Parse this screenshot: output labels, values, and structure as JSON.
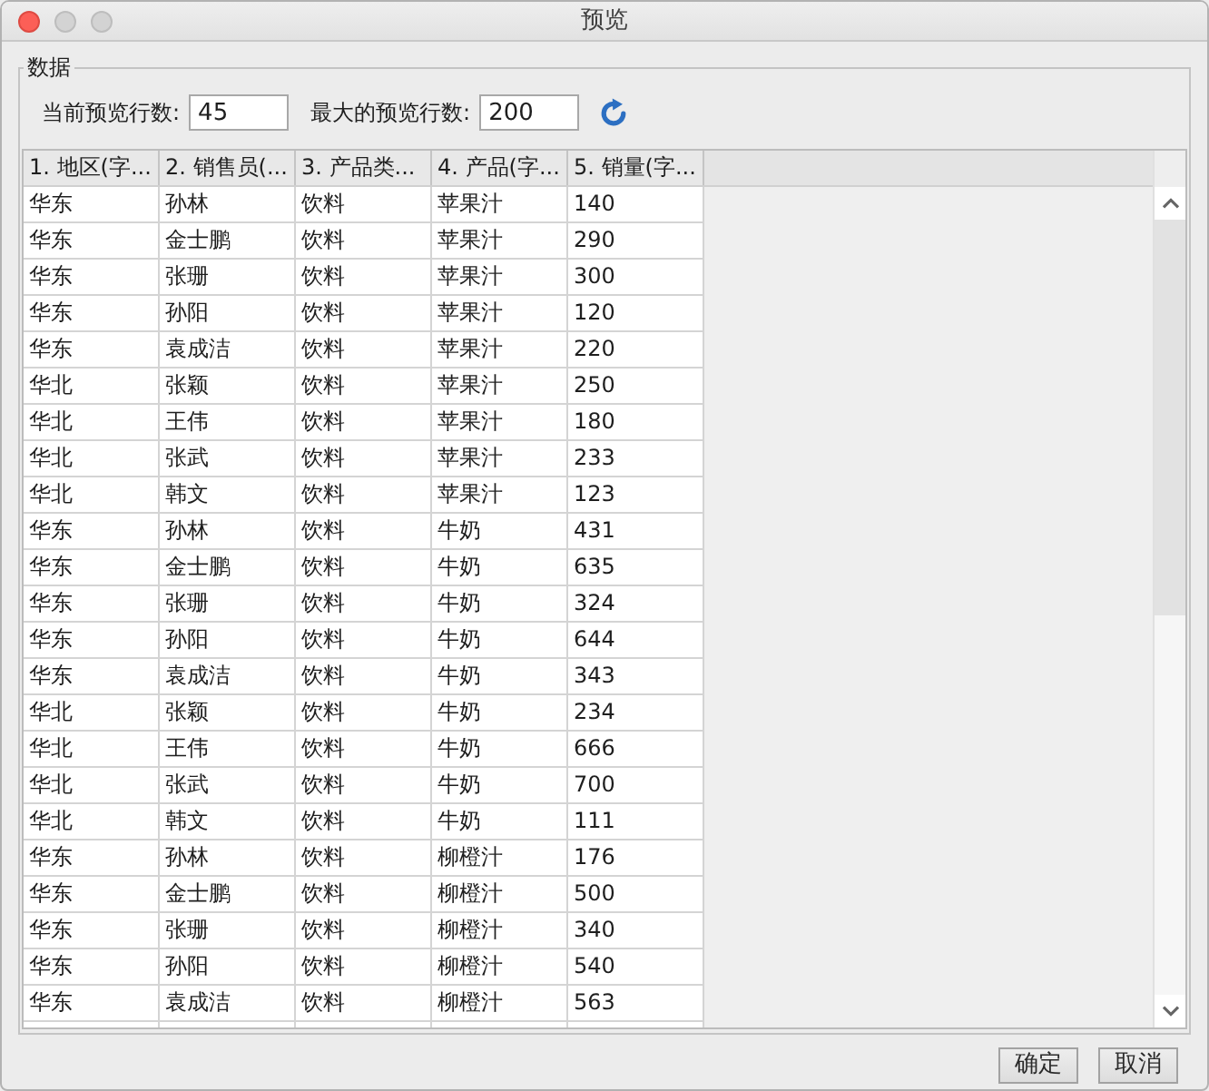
{
  "window": {
    "title": "预览",
    "controls": [
      {
        "kind": "close",
        "disabled": false
      },
      {
        "kind": "minimize",
        "disabled": true
      },
      {
        "kind": "zoom",
        "disabled": true
      }
    ]
  },
  "group": {
    "legend": "数据"
  },
  "fields": [
    {
      "label": "当前预览行数:",
      "value": "45"
    },
    {
      "label": "最大的预览行数:",
      "value": "200"
    }
  ],
  "table": {
    "columns": [
      "1. 地区(字...",
      "2. 销售员(...",
      "3. 产品类...",
      "4. 产品(字...",
      "5. 销量(字..."
    ],
    "rows": [
      [
        "华东",
        "孙林",
        "饮料",
        "苹果汁",
        "140"
      ],
      [
        "华东",
        "金士鹏",
        "饮料",
        "苹果汁",
        "290"
      ],
      [
        "华东",
        "张珊",
        "饮料",
        "苹果汁",
        "300"
      ],
      [
        "华东",
        "孙阳",
        "饮料",
        "苹果汁",
        "120"
      ],
      [
        "华东",
        "袁成洁",
        "饮料",
        "苹果汁",
        "220"
      ],
      [
        "华北",
        "张颖",
        "饮料",
        "苹果汁",
        "250"
      ],
      [
        "华北",
        "王伟",
        "饮料",
        "苹果汁",
        "180"
      ],
      [
        "华北",
        "张武",
        "饮料",
        "苹果汁",
        "233"
      ],
      [
        "华北",
        "韩文",
        "饮料",
        "苹果汁",
        "123"
      ],
      [
        "华东",
        "孙林",
        "饮料",
        "牛奶",
        "431"
      ],
      [
        "华东",
        "金士鹏",
        "饮料",
        "牛奶",
        "635"
      ],
      [
        "华东",
        "张珊",
        "饮料",
        "牛奶",
        "324"
      ],
      [
        "华东",
        "孙阳",
        "饮料",
        "牛奶",
        "644"
      ],
      [
        "华东",
        "袁成洁",
        "饮料",
        "牛奶",
        "343"
      ],
      [
        "华北",
        "张颖",
        "饮料",
        "牛奶",
        "234"
      ],
      [
        "华北",
        "王伟",
        "饮料",
        "牛奶",
        "666"
      ],
      [
        "华北",
        "张武",
        "饮料",
        "牛奶",
        "700"
      ],
      [
        "华北",
        "韩文",
        "饮料",
        "牛奶",
        "111"
      ],
      [
        "华东",
        "孙林",
        "饮料",
        "柳橙汁",
        "176"
      ],
      [
        "华东",
        "金士鹏",
        "饮料",
        "柳橙汁",
        "500"
      ],
      [
        "华东",
        "张珊",
        "饮料",
        "柳橙汁",
        "340"
      ],
      [
        "华东",
        "孙阳",
        "饮料",
        "柳橙汁",
        "540"
      ],
      [
        "华东",
        "袁成洁",
        "饮料",
        "柳橙汁",
        "563"
      ]
    ]
  },
  "buttons": [
    "确定",
    "取消"
  ]
}
